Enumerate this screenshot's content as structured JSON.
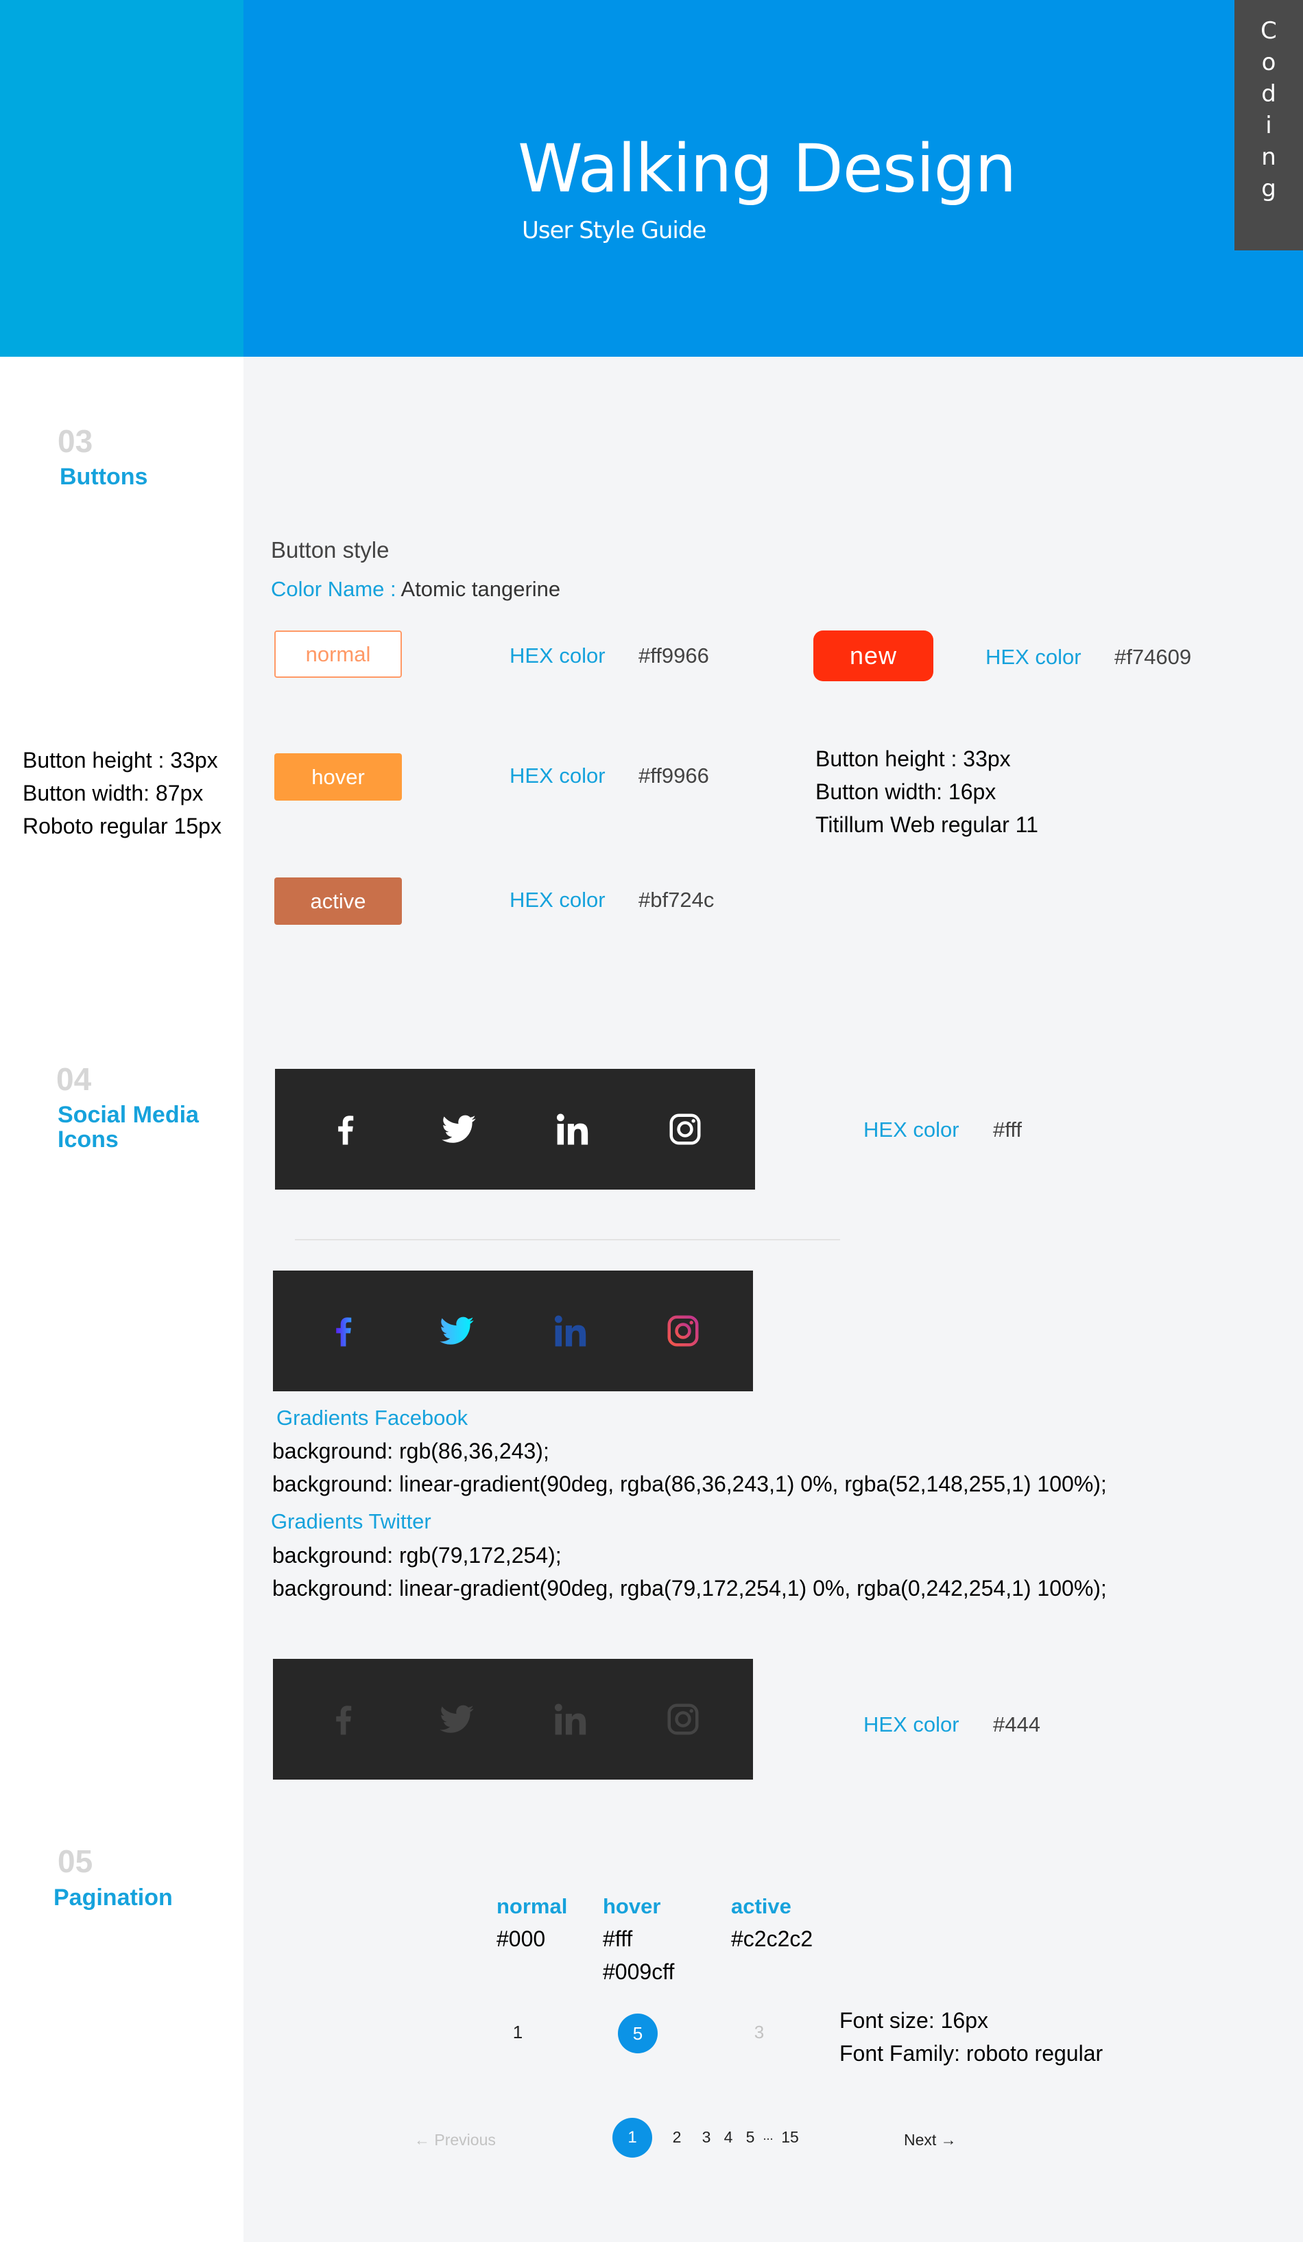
{
  "header": {
    "title": "Walking Design",
    "subtitle": "User Style Guide",
    "side_tab": [
      "C",
      "o",
      "d",
      "i",
      "n",
      "g"
    ]
  },
  "colors": {
    "accent": "#16a2dc",
    "header_blue": "#0093e8",
    "header_left": "#00a8e0",
    "dark_tab": "#4a4a4a",
    "bar": "#272727"
  },
  "buttons_section": {
    "number": "03",
    "name": "Buttons",
    "style_heading": "Button style",
    "color_name_label": "Color Name :",
    "color_name_value": "Atomic tangerine",
    "normal_label": "normal",
    "hover_label": "hover",
    "active_label": "active",
    "new_label": "new",
    "hex_label": "HEX color",
    "normal_hex": "#ff9966",
    "hover_hex": "#ff9966",
    "active_hex": "#bf724c",
    "new_hex": "#f74609",
    "left_specs": [
      "Button height : 33px",
      "Button width: 87px",
      "Roboto regular 15px"
    ],
    "right_specs": [
      "Button height : 33px",
      "Button width: 16px",
      "Titillum Web regular 11"
    ]
  },
  "social_section": {
    "number": "04",
    "name_line1": "Social Media",
    "name_line2": "Icons",
    "hex_label": "HEX color",
    "white_hex": "#fff",
    "dark_hex": "#444",
    "icons": [
      "facebook-icon",
      "twitter-icon",
      "linkedin-icon",
      "instagram-icon"
    ],
    "fb_title": "Gradients Facebook",
    "fb_line1": "background: rgb(86,36,243);",
    "fb_line2": "background: linear-gradient(90deg, rgba(86,36,243,1) 0%, rgba(52,148,255,1) 100%);",
    "tw_title": "Gradients Twitter",
    "tw_line1": "background: rgb(79,172,254);",
    "tw_line2": "background: linear-gradient(90deg, rgba(79,172,254,1) 0%, rgba(0,242,254,1) 100%);"
  },
  "pagination_section": {
    "number": "05",
    "name": "Pagination",
    "normal_label": "normal",
    "normal_value": "#000",
    "hover_label": "hover",
    "hover_value1": "#fff",
    "hover_value2": "#009cff",
    "active_label": "active",
    "active_value": "#c2c2c2",
    "demo_normal": "1",
    "demo_hover": "5",
    "demo_active": "3",
    "font_size": "Font size: 16px",
    "font_family": "Font Family: roboto regular",
    "prev_label": "← Previous",
    "next_label": "Next →",
    "pages": [
      "1",
      "2",
      "3",
      "4",
      "5",
      "...",
      "15"
    ]
  }
}
